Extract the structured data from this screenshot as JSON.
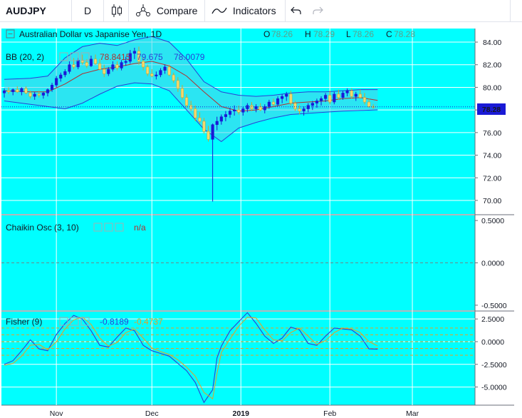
{
  "toolbar": {
    "symbol": "AUDJPY",
    "interval": "D",
    "compare_label": "Compare",
    "indicators_label": "Indicators",
    "icons": [
      "candles-icon",
      "compare-icon",
      "indicators-icon",
      "undo-icon",
      "redo-icon"
    ]
  },
  "colors": {
    "background": "#00ffff",
    "band_fill": "#4fd0e8",
    "band_line": "#2a3fd6",
    "basis_line": "#b03030",
    "up_candle": "#1a1ad6",
    "down_candle": "#f5d76e",
    "price_line": "#1a1ad6",
    "fisher_line": "#2a3fd6",
    "trigger_line": "#e8a020",
    "level_line": "#e8a020",
    "grid": "#ffffff"
  },
  "legend": {
    "title": "Australian Dollar vs Japanise Yen, 1D",
    "ohlc": [
      {
        "k": "O",
        "v": "78.26"
      },
      {
        "k": "H",
        "v": "78.29"
      },
      {
        "k": "L",
        "v": "78.26"
      },
      {
        "k": "C",
        "v": "78.28"
      }
    ],
    "bb_label": "BB (20, 2)",
    "bb_values": [
      "78.8415",
      "79.675",
      "78.0079"
    ],
    "chaikin_label": "Chaikin Osc (3, 10)",
    "chaikin_value": "n/a",
    "fisher_label": "Fisher (9)",
    "fisher_values": [
      "-0.8189",
      "-0.4737"
    ]
  },
  "price_tag": "78.28",
  "chart_data": [
    {
      "type": "candlestick",
      "panel": "price",
      "title": "Australian Dollar vs Japanise Yen, 1D",
      "ylim": [
        68.8,
        85.2
      ],
      "yticks": [
        "84.00",
        "82.00",
        "80.00",
        "78.00",
        "76.00",
        "74.00",
        "72.00",
        "70.00"
      ],
      "xticks": [
        {
          "label": "Nov",
          "x": 12
        },
        {
          "label": "Dec",
          "x": 34
        },
        {
          "label": "2019",
          "x": 54.5
        },
        {
          "label": "Feb",
          "x": 75
        },
        {
          "label": "Mar",
          "x": 94
        }
      ],
      "xlim": [
        0,
        104
      ],
      "last_price": 78.28,
      "ohlc": [
        [
          79.5,
          79.9,
          79.1,
          79.7
        ],
        [
          79.7,
          80.0,
          79.4,
          79.6
        ],
        [
          79.6,
          79.9,
          79.3,
          79.8
        ],
        [
          79.8,
          80.1,
          79.5,
          79.6
        ],
        [
          79.6,
          80.0,
          79.3,
          79.9
        ],
        [
          79.9,
          80.1,
          79.4,
          79.5
        ],
        [
          79.5,
          79.7,
          79.0,
          79.2
        ],
        [
          79.2,
          79.6,
          78.9,
          79.4
        ],
        [
          79.4,
          79.7,
          79.1,
          79.3
        ],
        [
          79.3,
          79.6,
          79.0,
          79.5
        ],
        [
          79.5,
          79.9,
          79.2,
          79.8
        ],
        [
          79.8,
          80.4,
          79.6,
          80.2
        ],
        [
          80.2,
          81.0,
          80.0,
          80.8
        ],
        [
          80.8,
          81.3,
          80.5,
          81.1
        ],
        [
          81.1,
          81.6,
          80.9,
          81.4
        ],
        [
          81.4,
          82.3,
          81.2,
          82.0
        ],
        [
          82.0,
          82.6,
          81.6,
          81.8
        ],
        [
          81.8,
          82.6,
          81.6,
          82.4
        ],
        [
          82.4,
          82.9,
          82.0,
          82.2
        ],
        [
          82.2,
          82.5,
          81.7,
          81.9
        ],
        [
          81.9,
          82.8,
          81.8,
          82.5
        ],
        [
          82.5,
          82.9,
          82.0,
          82.1
        ],
        [
          82.1,
          82.5,
          81.5,
          81.6
        ],
        [
          81.6,
          82.0,
          80.9,
          81.2
        ],
        [
          81.2,
          81.8,
          81.0,
          81.6
        ],
        [
          81.6,
          82.3,
          81.4,
          82.0
        ],
        [
          82.0,
          82.3,
          81.5,
          81.7
        ],
        [
          81.7,
          82.4,
          81.5,
          82.2
        ],
        [
          82.2,
          82.7,
          81.9,
          82.3
        ],
        [
          82.3,
          83.3,
          82.1,
          83.0
        ],
        [
          83.0,
          83.5,
          82.5,
          83.2
        ],
        [
          83.2,
          83.6,
          82.0,
          82.3
        ],
        [
          82.3,
          82.6,
          81.5,
          81.8
        ],
        [
          81.8,
          82.0,
          81.0,
          81.2
        ],
        [
          81.2,
          81.6,
          80.9,
          81.0
        ],
        [
          81.0,
          81.4,
          80.7,
          81.1
        ],
        [
          81.1,
          81.7,
          80.9,
          81.5
        ],
        [
          81.5,
          82.0,
          81.2,
          81.8
        ],
        [
          81.8,
          82.0,
          81.0,
          81.1
        ],
        [
          81.1,
          81.3,
          80.4,
          80.6
        ],
        [
          80.6,
          80.9,
          79.6,
          79.9
        ],
        [
          79.9,
          80.2,
          78.9,
          79.1
        ],
        [
          79.1,
          79.4,
          78.2,
          78.4
        ],
        [
          78.4,
          78.8,
          77.9,
          78.1
        ],
        [
          78.1,
          78.4,
          77.0,
          77.3
        ],
        [
          77.3,
          77.8,
          76.8,
          77.0
        ],
        [
          77.0,
          77.3,
          75.9,
          76.1
        ],
        [
          76.1,
          76.6,
          75.2,
          75.4
        ],
        [
          75.4,
          76.8,
          69.9,
          76.7
        ],
        [
          76.7,
          77.4,
          76.2,
          77.0
        ],
        [
          77.0,
          77.6,
          76.7,
          77.4
        ],
        [
          77.4,
          77.9,
          77.0,
          77.6
        ],
        [
          77.6,
          78.2,
          77.3,
          77.9
        ],
        [
          77.9,
          78.4,
          77.5,
          78.0
        ],
        [
          78.0,
          78.4,
          77.6,
          77.8
        ],
        [
          77.8,
          78.3,
          77.5,
          78.1
        ],
        [
          78.1,
          78.6,
          77.8,
          78.4
        ],
        [
          78.4,
          78.7,
          77.9,
          78.1
        ],
        [
          78.1,
          78.5,
          77.8,
          78.3
        ],
        [
          78.3,
          78.6,
          77.9,
          78.0
        ],
        [
          78.0,
          78.5,
          77.7,
          78.3
        ],
        [
          78.3,
          78.9,
          78.1,
          78.7
        ],
        [
          78.7,
          79.0,
          78.3,
          78.5
        ],
        [
          78.5,
          79.2,
          78.3,
          79.0
        ],
        [
          79.0,
          79.4,
          78.6,
          79.2
        ],
        [
          79.2,
          79.6,
          78.8,
          79.4
        ],
        [
          79.4,
          79.7,
          78.4,
          78.6
        ],
        [
          78.6,
          78.8,
          77.9,
          78.1
        ],
        [
          78.1,
          78.4,
          77.6,
          77.9
        ],
        [
          77.9,
          78.3,
          77.5,
          78.1
        ],
        [
          78.1,
          78.6,
          77.8,
          78.4
        ],
        [
          78.4,
          78.8,
          78.0,
          78.6
        ],
        [
          78.6,
          79.0,
          78.2,
          78.8
        ],
        [
          78.8,
          79.2,
          78.4,
          79.0
        ],
        [
          79.0,
          79.5,
          78.7,
          79.3
        ],
        [
          79.3,
          79.7,
          78.5,
          78.7
        ],
        [
          78.7,
          79.6,
          78.5,
          79.4
        ],
        [
          79.4,
          79.8,
          78.9,
          79.1
        ],
        [
          79.1,
          79.7,
          78.9,
          79.5
        ],
        [
          79.5,
          79.9,
          79.2,
          79.7
        ],
        [
          79.7,
          79.9,
          79.0,
          79.2
        ],
        [
          79.2,
          79.6,
          78.8,
          79.4
        ],
        [
          79.4,
          79.8,
          79.0,
          79.1
        ],
        [
          79.1,
          79.5,
          78.5,
          78.7
        ],
        [
          78.7,
          79.0,
          78.2,
          78.3
        ],
        [
          78.3,
          78.5,
          78.1,
          78.28
        ]
      ],
      "bollinger": {
        "upper": [
          [
            0,
            80.7
          ],
          [
            6,
            80.8
          ],
          [
            10,
            81.0
          ],
          [
            14,
            82.6
          ],
          [
            18,
            83.6
          ],
          [
            22,
            83.9
          ],
          [
            26,
            83.7
          ],
          [
            30,
            84.2
          ],
          [
            34,
            84.5
          ],
          [
            38,
            84.0
          ],
          [
            42,
            82.5
          ],
          [
            46,
            80.5
          ],
          [
            50,
            79.6
          ],
          [
            54,
            79.3
          ],
          [
            58,
            79.2
          ],
          [
            62,
            79.3
          ],
          [
            66,
            79.5
          ],
          [
            70,
            79.6
          ],
          [
            74,
            79.6
          ],
          [
            78,
            79.7
          ],
          [
            82,
            79.8
          ],
          [
            86,
            79.8
          ]
        ],
        "middle": [
          [
            0,
            79.7
          ],
          [
            6,
            79.6
          ],
          [
            10,
            79.6
          ],
          [
            14,
            80.3
          ],
          [
            18,
            81.2
          ],
          [
            22,
            81.6
          ],
          [
            26,
            81.8
          ],
          [
            30,
            82.1
          ],
          [
            34,
            82.3
          ],
          [
            38,
            81.9
          ],
          [
            42,
            81.0
          ],
          [
            46,
            79.6
          ],
          [
            50,
            78.3
          ],
          [
            54,
            77.9
          ],
          [
            58,
            78.0
          ],
          [
            62,
            78.3
          ],
          [
            66,
            78.6
          ],
          [
            70,
            78.7
          ],
          [
            74,
            78.8
          ],
          [
            78,
            79.0
          ],
          [
            82,
            79.1
          ],
          [
            86,
            78.84
          ]
        ],
        "lower": [
          [
            0,
            78.8
          ],
          [
            6,
            78.5
          ],
          [
            10,
            78.3
          ],
          [
            14,
            78.1
          ],
          [
            18,
            78.6
          ],
          [
            22,
            79.4
          ],
          [
            26,
            80.1
          ],
          [
            30,
            80.4
          ],
          [
            34,
            80.3
          ],
          [
            38,
            79.7
          ],
          [
            42,
            78.0
          ],
          [
            46,
            76.3
          ],
          [
            50,
            75.2
          ],
          [
            54,
            76.4
          ],
          [
            58,
            76.9
          ],
          [
            62,
            77.3
          ],
          [
            66,
            77.6
          ],
          [
            70,
            77.7
          ],
          [
            74,
            77.8
          ],
          [
            78,
            77.9
          ],
          [
            82,
            77.95
          ],
          [
            86,
            78.01
          ]
        ]
      }
    },
    {
      "type": "line",
      "panel": "chaikin",
      "title": "Chaikin Osc (3, 10)",
      "ylim": [
        -0.56,
        0.56
      ],
      "yticks": [
        "0.5000",
        "0.0000",
        "-0.5000"
      ],
      "series": []
    },
    {
      "type": "line",
      "panel": "fisher",
      "title": "Fisher (9)",
      "ylim": [
        -7.0,
        3.3
      ],
      "yticks": [
        "2.5000",
        "0.0000",
        "-2.5000",
        "-5.0000"
      ],
      "levels": [
        1.5,
        0.75,
        0,
        -0.75,
        -1.5
      ],
      "series": [
        {
          "name": "Fisher",
          "x": [
            0,
            2,
            4,
            6,
            8,
            10,
            12,
            14,
            16,
            18,
            20,
            22,
            24,
            26,
            28,
            30,
            32,
            34,
            36,
            38,
            40,
            42,
            44,
            46,
            48,
            49,
            50,
            52,
            54,
            56,
            58,
            60,
            62,
            64,
            66,
            68,
            70,
            72,
            74,
            76,
            78,
            80,
            82,
            84,
            86
          ],
          "values": [
            -2.5,
            -2.1,
            -1.0,
            0.2,
            -0.8,
            -1.0,
            0.8,
            2.0,
            2.9,
            2.5,
            1.2,
            -0.4,
            -0.6,
            0.5,
            1.5,
            1.2,
            -0.4,
            -1.0,
            -1.3,
            -1.6,
            -2.4,
            -3.2,
            -4.5,
            -6.7,
            -5.3,
            -1.8,
            -0.5,
            1.2,
            2.2,
            3.2,
            2.0,
            0.6,
            -0.2,
            0.4,
            1.6,
            1.3,
            -0.2,
            -0.4,
            0.6,
            1.5,
            1.4,
            1.3,
            0.6,
            -0.8,
            -0.82
          ]
        },
        {
          "name": "Trigger",
          "x": [
            0,
            2,
            4,
            6,
            8,
            10,
            12,
            14,
            16,
            18,
            20,
            22,
            24,
            26,
            28,
            30,
            32,
            34,
            36,
            38,
            40,
            42,
            44,
            46,
            48,
            49,
            50,
            52,
            54,
            56,
            58,
            60,
            62,
            64,
            66,
            68,
            70,
            72,
            74,
            76,
            78,
            80,
            82,
            84,
            86
          ],
          "values": [
            -2.6,
            -2.4,
            -1.6,
            -0.4,
            -0.3,
            -0.9,
            0.0,
            1.4,
            2.4,
            2.7,
            1.9,
            0.4,
            -0.5,
            -0.1,
            1.0,
            1.4,
            0.4,
            -0.7,
            -1.1,
            -1.4,
            -2.0,
            -2.8,
            -3.8,
            -5.6,
            -6.3,
            -3.5,
            -1.2,
            0.3,
            1.7,
            2.7,
            2.6,
            1.3,
            0.2,
            0.1,
            1.0,
            1.5,
            0.6,
            -0.3,
            0.1,
            1.0,
            1.5,
            1.4,
            1.0,
            0.0,
            -0.47
          ]
        }
      ]
    }
  ]
}
